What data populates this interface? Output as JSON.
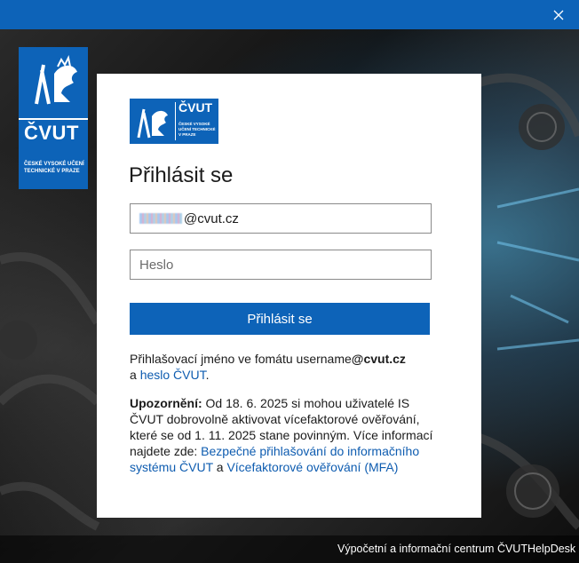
{
  "window": {
    "close_icon": "close-icon"
  },
  "corner_logo": {
    "brand": "ČVUT",
    "subtitle": "ČESKÉ VYSOKÉ UČENÍ TECHNICKÉ V PRAZE"
  },
  "card": {
    "logo": {
      "brand": "ČVUT",
      "subtitle": "ČESKÉ VYSOKÉ UČENÍ TECHNICKÉ V PRAZE"
    },
    "heading": "Přihlásit se",
    "email_suffix": "@cvut.cz",
    "password_placeholder": "Heslo",
    "submit_label": "Přihlásit se",
    "info_text_1": "Přihlašovací jméno ve fomátu username",
    "info_bold": "@cvut.cz",
    "info_text_2": "a ",
    "info_link": "heslo ČVUT",
    "info_text_3": ".",
    "warn_bold": "Upozornění:",
    "warn_text": " Od 18. 6. 2025 si mohou uživatelé IS ČVUT dobrovolně aktivovat vícefaktorové ověřování, které se od 1. 11. 2025 stane povinným. Více informací najdete zde: ",
    "warn_link_1": "Bezpečné přihlašování do informačního systému ČVUT",
    "warn_and": " a ",
    "warn_link_2": "Vícefaktorové ověřování (MFA)"
  },
  "footer": {
    "link_1": "Výpočetní a informační centrum ČVUT",
    "link_2": "HelpDesk"
  },
  "colors": {
    "accent": "#0d63b8",
    "link": "#0e5cb0"
  }
}
